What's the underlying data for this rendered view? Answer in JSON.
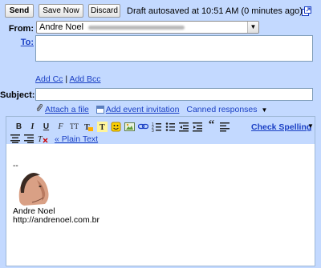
{
  "toolbar_top": {
    "send_label": "Send",
    "save_label": "Save Now",
    "discard_label": "Discard",
    "draft_status": "Draft autosaved at 10:51 AM (0 minutes ago)"
  },
  "from": {
    "label": "From:",
    "value": "Andre Noel"
  },
  "to": {
    "label": "To:",
    "value": "",
    "add_cc": "Add Cc",
    "separator": "|",
    "add_bcc": "Add Bcc"
  },
  "subject": {
    "label": "Subject:",
    "value": ""
  },
  "attachments": {
    "attach_label": "Attach a file",
    "event_label": "Add event invitation",
    "canned_label": "Canned responses"
  },
  "editor_toolbar": {
    "bold": "B",
    "italic": "I",
    "underline": "U",
    "font": "F",
    "size": "TT",
    "check_spelling": "Check Spelling",
    "plain_text": "« Plain Text"
  },
  "signature": {
    "dash": "--",
    "name": "Andre Noel",
    "url": "http://andrenoel.com.br"
  },
  "colors": {
    "frame_bg": "#c3d9ff",
    "link": "#1a3fc4"
  }
}
